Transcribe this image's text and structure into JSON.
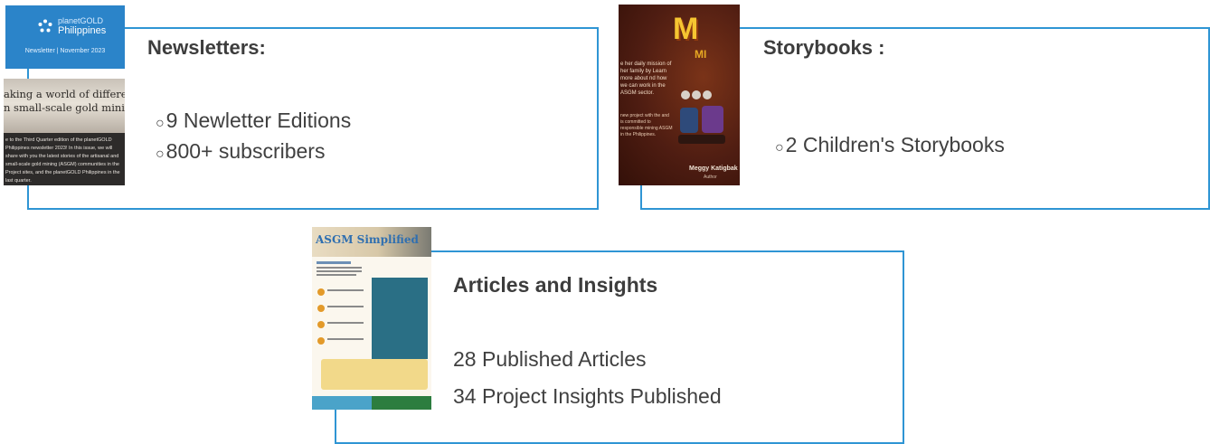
{
  "newsletters": {
    "title": "Newsletters:",
    "lines": [
      "9 Newletter Editions",
      "800+ subscribers"
    ],
    "thumb": {
      "brand_top": "planetGOLD",
      "brand_bottom": "Philippines",
      "issue": "Newsletter | November 2023",
      "headline": [
        "aking a world of differe",
        "n small-scale gold minin"
      ],
      "body": "e to the Third Quarter edition of the planetGOLD Philippines newsletter 2023! In this issue, we will share with you the latest stories of the artisanal and small-scale gold mining (ASGM) communities in the Project sites, and the planetGOLD Philippines in the last quarter."
    }
  },
  "storybooks": {
    "title": "Storybooks :",
    "lines": [
      "2 Children's Storybooks"
    ],
    "thumb": {
      "title": "M",
      "subtitle": "MI",
      "text1": "e her daily mission of her family by Learn more about nd how we can work in the ASGM sector.",
      "text2": "new project with the and is committed to responsible mining ASGM in the Philippines.",
      "author": "Meggy Katigbak",
      "role": "Author"
    }
  },
  "articles": {
    "title": "Articles and Insights",
    "lines": [
      "28 Published Articles",
      "34 Project Insights Published"
    ],
    "thumb": {
      "title": "ASGM Simplified"
    }
  },
  "colors": {
    "frame": "#2f95d4",
    "text": "#404040"
  }
}
